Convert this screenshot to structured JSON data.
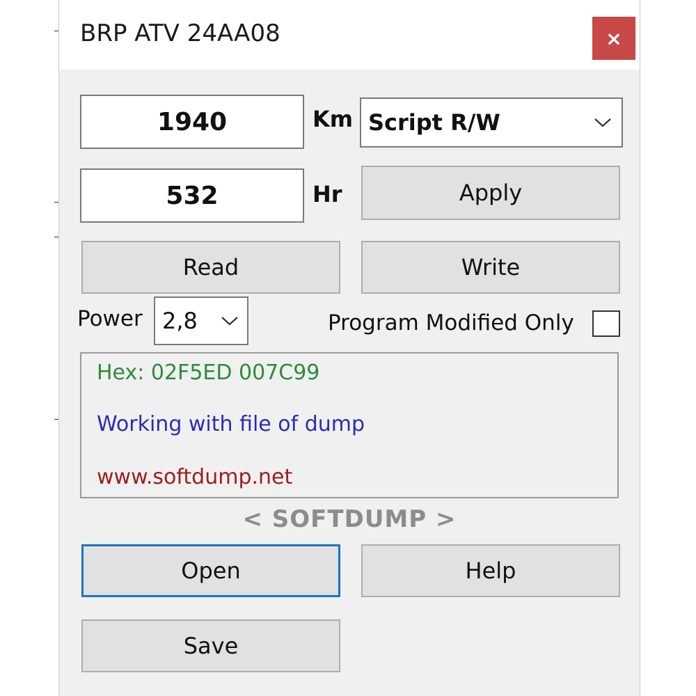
{
  "window": {
    "title": "BRP ATV 24AA08",
    "close_label": "×"
  },
  "odometer": {
    "km_value": "1940",
    "km_unit": "Km",
    "hr_value": "532",
    "hr_unit": "Hr"
  },
  "mode_select": {
    "selected": "Script R/W"
  },
  "buttons": {
    "apply": "Apply",
    "read": "Read",
    "write": "Write",
    "open": "Open",
    "help": "Help",
    "save": "Save"
  },
  "power": {
    "label": "Power",
    "selected": "2,8"
  },
  "program_modified_only": {
    "label": "Program Modified Only",
    "checked": false
  },
  "log": {
    "lines": [
      {
        "text": "Hex: 02F5ED 007C99",
        "color": "#2e8b3a"
      },
      {
        "text": "Working with file of dump",
        "color": "#2c2cb4"
      },
      {
        "text": "www.softdump.net",
        "color": "#9a2020"
      }
    ]
  },
  "brand": "< SOFTDUMP >",
  "colors": {
    "close_bg": "#c94848",
    "focus_border": "#1a74c7",
    "window_bg": "#f0f0f0"
  },
  "icons": {
    "close": "close-icon",
    "dropdown": "chevron-down-icon"
  }
}
